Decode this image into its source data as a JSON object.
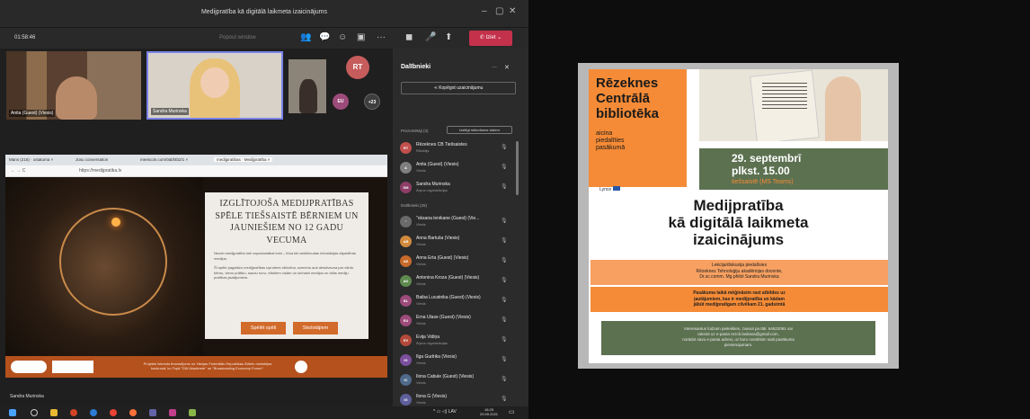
{
  "teams": {
    "window_title": "Medijpratība kā digitālā laikmeta izaicinājums",
    "timer": "01:58:46",
    "pop_out": "Popout window",
    "leave_label": "Iziet",
    "tiles": [
      {
        "name": "Anita (Guest) (Viesis)"
      },
      {
        "name": "Sandra Murinska"
      }
    ],
    "avatars": {
      "rt": "RT",
      "eu": "EU",
      "more": "+23"
    },
    "active_speaker": "Sandra Murinska"
  },
  "browser": {
    "tabs": [
      "Mans (216) · ostatuma ×",
      "Jūsu conversation",
      "meetcoin.com/0abf4b2/1 ×",
      "medijpratibas · Medijpratība ×"
    ],
    "address": "https://medijpratiba.lv",
    "card_title": "IZGLĪTOJOŠA MEDIJPRATĪBAS SPĒLE TIEŠSAISTĒ BĒRNIEM UN JAUNIEŠIEM NO 12 GADU VECUMA",
    "card_p1": "Nezob medijpratība nek saprotamākai lotni – tūna kā medžimudas infomācijas atpaidības medijus.",
    "card_p2": "Šī spēle pagatāvu medijpratības izprotnes viktorīna, scenerio auš atnsāvsona par vārdu bērnu, vieno politiku, saudu runu, viltotiem ziņām un sirīnaini medijus un citās mediju pratības jautājumiem.",
    "play_btn": "Spēlēt spēli",
    "teachers_btn": "Skolotājiem",
    "footer_text": "Projekts īstenots finansējums no Vācijas Federālās Republikas Ārlietu ministrijas konkursā, ko Topā \"DW Akademie\" un \"Broadcasting Economy Forum\"."
  },
  "participants": {
    "title": "Dalībnieki",
    "copy_link": "Kopēgot uzaicinājumu",
    "presenters_label": "Prezentētāji (3)",
    "mute_all": "Izslēgt mikrofonus visiem",
    "attendees_label": "Dalībnieki (25)",
    "presenters": [
      {
        "initials": "RT",
        "name": "Rēzeknes CB Tiešsaistes",
        "role": "Rīkotājs",
        "color": "#c0504d"
      },
      {
        "initials": "A",
        "name": "Anita (Guest) (Viesis)",
        "role": "Viesis",
        "color": "#7f7f7f"
      },
      {
        "initials": "SM",
        "name": "Sandra Murinska",
        "role": "Ārpus organizācijas",
        "color": "#8e3e68"
      }
    ],
    "attendees": [
      {
        "initials": "\"",
        "name": "\"oksana lenikane (Guest) (Vie...",
        "role": "Viesis",
        "color": "#6a6a6a"
      },
      {
        "initials": "AB",
        "name": "Anna Bartuša (Viesis)",
        "role": "Viesis",
        "color": "#d18a3c"
      },
      {
        "initials": "AE",
        "name": "Anna Erta (Guest) (Viesis)",
        "role": "Viesis",
        "color": "#c76a2a"
      },
      {
        "initials": "AK",
        "name": "Antonina Kroza (Guest) (Viesis)",
        "role": "Viesis",
        "color": "#5f8a4f"
      },
      {
        "initials": "BL",
        "name": "Baiba Lucatnika (Guest) (Viesis)",
        "role": "Viesis",
        "color": "#9c4b7a"
      },
      {
        "initials": "EU",
        "name": "Erna Ulase (Guest) (Viesis)",
        "role": "Viesis",
        "color": "#9c4b7a"
      },
      {
        "initials": "EV",
        "name": "Evija Vidiņa",
        "role": "Ārpus organizācijas",
        "color": "#b2493a"
      },
      {
        "initials": "IG",
        "name": "Ilga Gudrika (Viesis)",
        "role": "Viesis",
        "color": "#7b4f9c"
      },
      {
        "initials": "IC",
        "name": "Ilona Cabule (Guest) (Viesis)",
        "role": "Viesis",
        "color": "#4f6a8a"
      },
      {
        "initials": "IG",
        "name": "Ilona G (Viesis)",
        "role": "Viesis",
        "color": "#5f5f9c"
      }
    ]
  },
  "taskbar": {
    "time": "16:25",
    "date": "29.09.2021",
    "lang": "LAV"
  },
  "poster": {
    "title_lines": [
      "Rēzeknes",
      "Centrālā",
      "bibliotēka"
    ],
    "subtitle_lines": [
      "aicina",
      "piedalīties",
      "pasākumā"
    ],
    "date": "29. septembrī",
    "time": "plkst. 15.00",
    "online": "tiešsaistē (MS Teams)",
    "logo": "Lynce",
    "main_title_lines": [
      "Medijpratība",
      "kā digitālā laikmeta",
      "izaicinājums"
    ],
    "lecture_lines": [
      "Lekcija/diskusija piedalīsies",
      "Rēzeknes Tehnoloģiju akadēmijas docente,",
      "Dr.sc.comm. Mg.philol Sandra Murinska"
    ],
    "question_lines": [
      "Pasākuma laikā mēģināsim rast atbildes uz",
      "jautājumiem, kas ir medijpratība un kādam",
      "jābūt medijpratīgam cilvēkam 21. gadsimtā"
    ],
    "contact_lines": [
      "Interesantus lūdzam pieteikties, zvanot pa tālr. 64622061 vai",
      "rakstot uz e-pasta rezcb.lasitava@gmail.com,",
      "norādot savu e-pasta adresi, uz kuru nosūtīsim saiti pasākuma",
      "pievienojumam."
    ]
  }
}
